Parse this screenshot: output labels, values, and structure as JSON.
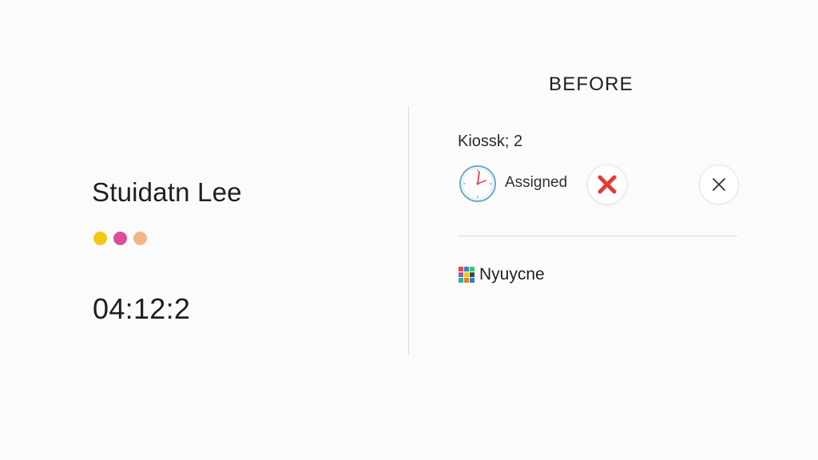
{
  "student": {
    "name": "Stuidatn Lee",
    "timer": "04:12:2",
    "dots": [
      {
        "color": "#f2c814"
      },
      {
        "color": "#e04c9b"
      },
      {
        "color": "#f1b787"
      }
    ]
  },
  "panel": {
    "title": "BEFORE",
    "kiosk_label": "Kiossk; 2",
    "status": {
      "icon": "clock-icon",
      "label": "Assigned"
    },
    "actions": {
      "reject_icon": "red-x-icon",
      "close_icon": "close-icon"
    },
    "assignee": {
      "icon": "grid-app-icon",
      "name": "Nyuycne"
    }
  },
  "colors": {
    "background": "#fbfbfb",
    "reject": "#e53935",
    "clock_hand": "#e25050",
    "clock_ring": "#6fa9c9"
  }
}
